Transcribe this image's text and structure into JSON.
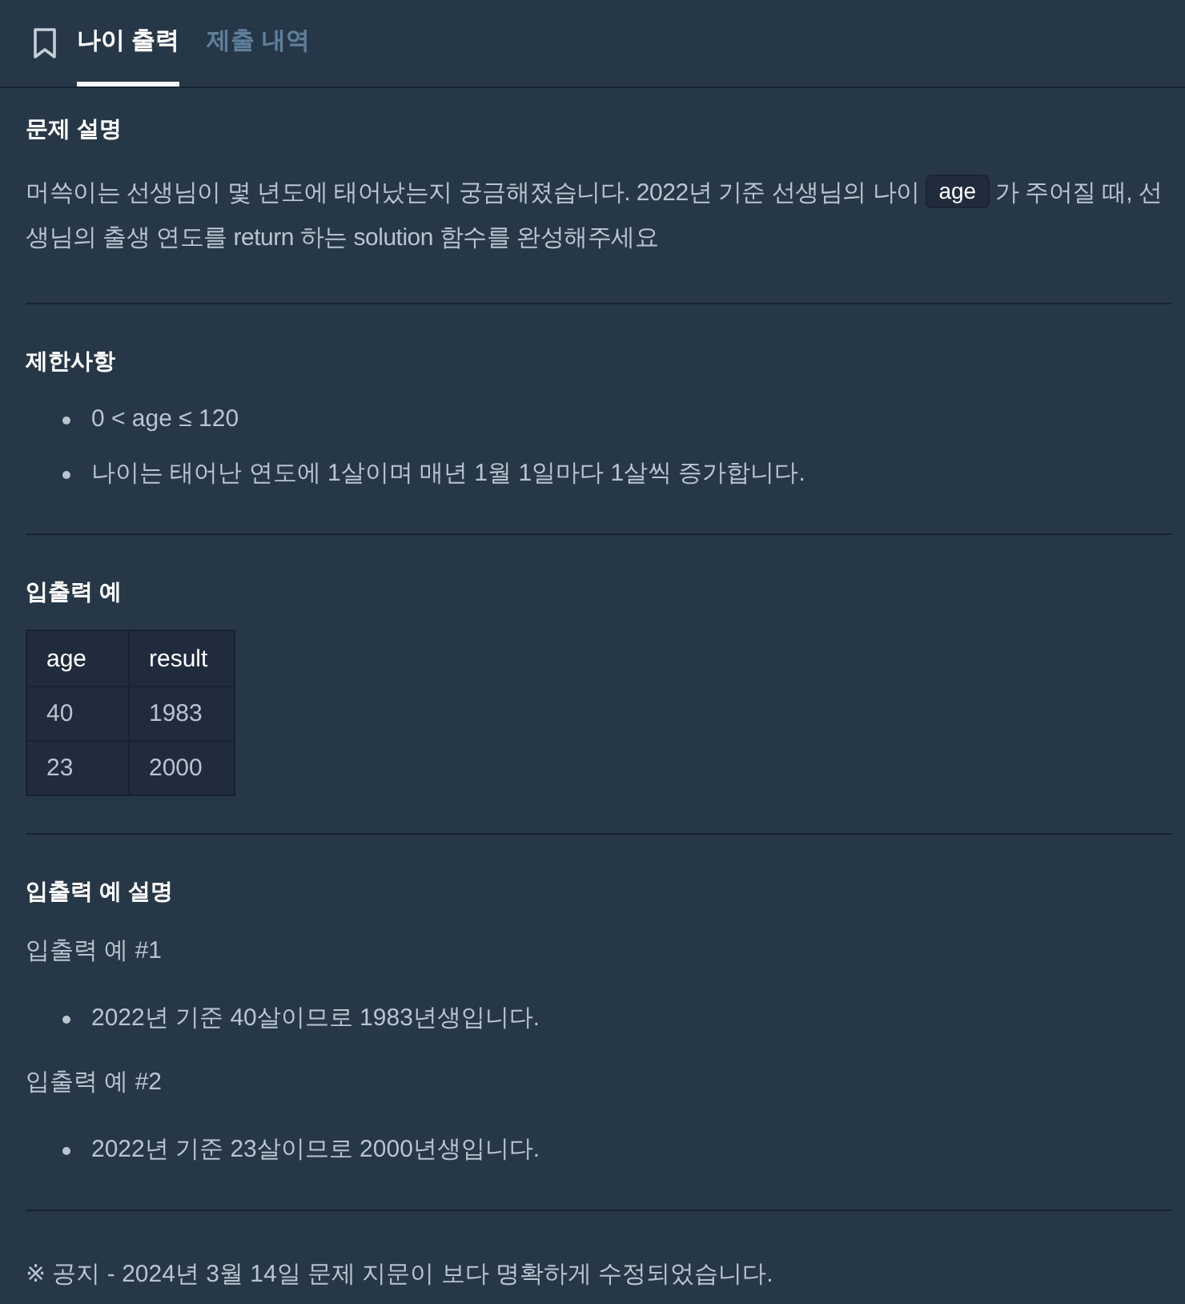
{
  "tabs": [
    {
      "label": "나이 출력",
      "selected": true
    },
    {
      "label": "제출 내역",
      "selected": false
    }
  ],
  "sections": [
    {
      "blocks": [
        {
          "kind": "heading",
          "text": "문제 설명"
        },
        {
          "kind": "mixed_paragraph",
          "parts": [
            {
              "kind": "text",
              "text": "머쓱이는 선생님이 몇 년도에 태어났는지 궁금해졌습니다. 2022년 기준 선생님의 나이 "
            },
            {
              "kind": "code",
              "text": "age"
            },
            {
              "kind": "text",
              "text": " 가 주어질 때, 선생님의 출생 연도를 return 하는 solution 함수를 완성해주세요"
            }
          ]
        }
      ]
    },
    {
      "blocks": [
        {
          "kind": "heading",
          "text": "제한사항"
        },
        {
          "kind": "list",
          "items": [
            "0 < age ≤ 120",
            "나이는 태어난 연도에 1살이며 매년 1월 1일마다 1살씩 증가합니다."
          ]
        }
      ]
    },
    {
      "blocks": [
        {
          "kind": "heading",
          "text": "입출력 예"
        },
        {
          "kind": "table",
          "columns": [
            "age",
            "result"
          ],
          "rows": [
            [
              "40",
              "1983"
            ],
            [
              "23",
              "2000"
            ]
          ]
        }
      ]
    },
    {
      "blocks": [
        {
          "kind": "heading",
          "text": "입출력 예 설명"
        },
        {
          "kind": "paragraph",
          "text": "입출력 예 #1"
        },
        {
          "kind": "list",
          "items": [
            "2022년 기준 40살이므로 1983년생입니다."
          ]
        },
        {
          "kind": "paragraph",
          "text": "입출력 예 #2"
        },
        {
          "kind": "list",
          "items": [
            "2022년 기준 23살이므로 2000년생입니다."
          ]
        }
      ]
    },
    {
      "blocks": [
        {
          "kind": "notice",
          "text": "※ 공지 - 2024년 3월 14일 문제 지문이 보다 명확하게 수정되었습니다."
        }
      ]
    }
  ]
}
